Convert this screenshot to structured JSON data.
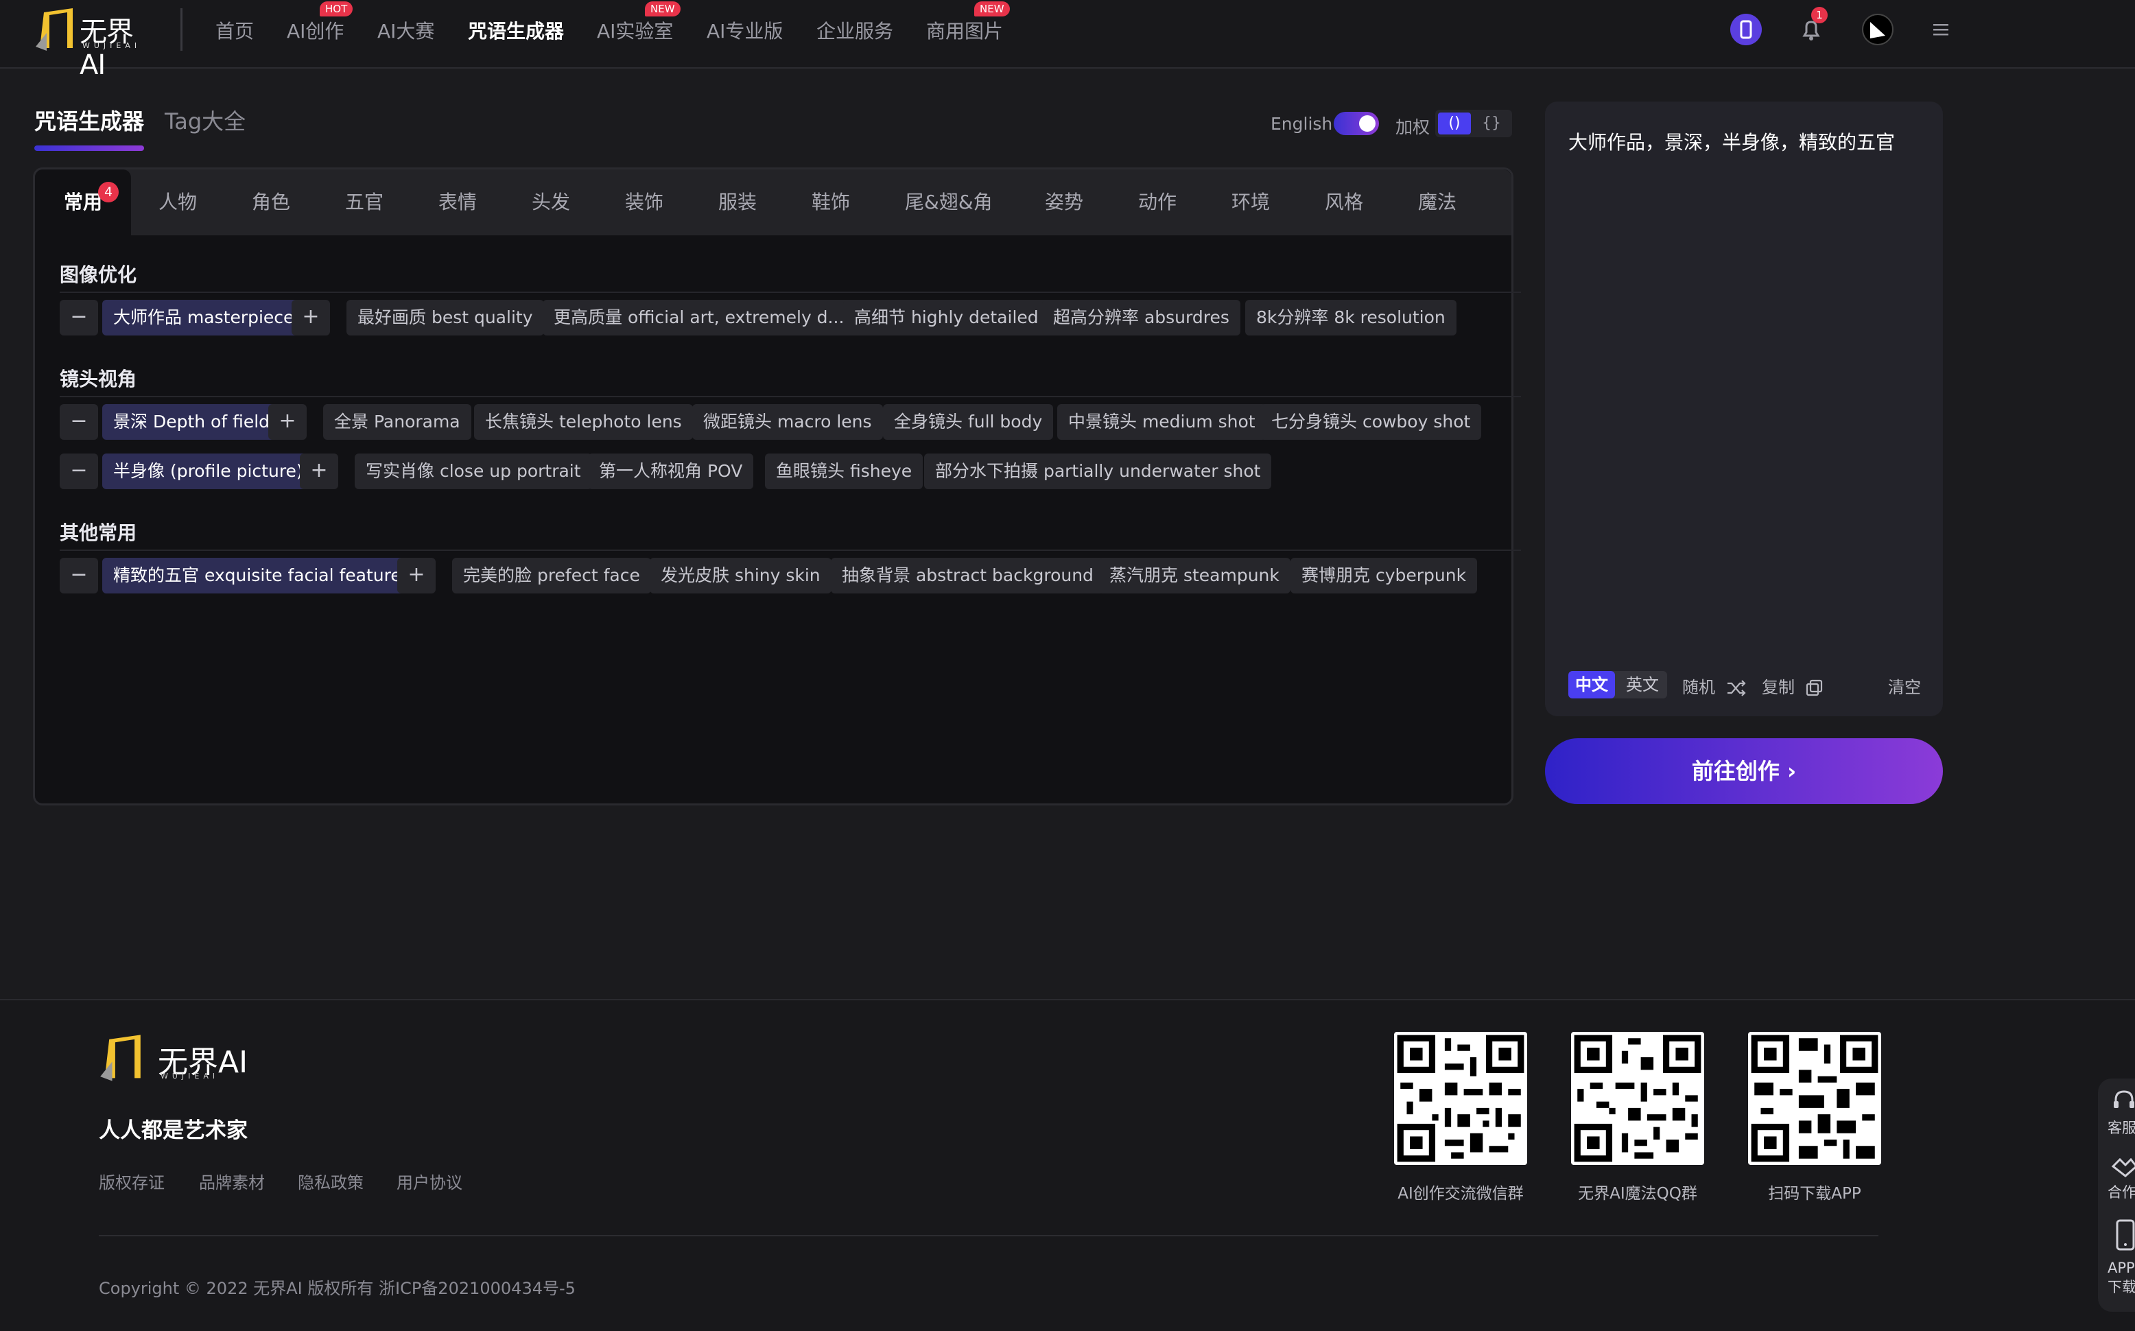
{
  "header": {
    "logo_text": "无界AI",
    "logo_sub": "WUJIEAI",
    "nav": [
      {
        "label": "首页"
      },
      {
        "label": "AI创作",
        "badge": "HOT"
      },
      {
        "label": "AI大赛"
      },
      {
        "label": "咒语生成器",
        "active": true
      },
      {
        "label": "AI实验室",
        "badge": "NEW"
      },
      {
        "label": "AI专业版"
      },
      {
        "label": "企业服务"
      },
      {
        "label": "商用图片",
        "badge": "NEW"
      }
    ],
    "notification_count": "1"
  },
  "main_tabs": [
    {
      "label": "咒语生成器",
      "active": true
    },
    {
      "label": "Tag大全"
    }
  ],
  "controls": {
    "english_label": "English",
    "english_on": true,
    "weight_label": "加权",
    "weight_options": [
      "()",
      "{}"
    ],
    "weight_selected": "()"
  },
  "categories": {
    "items": [
      "常用",
      "人物",
      "角色",
      "五官",
      "表情",
      "头发",
      "装饰",
      "服装",
      "鞋饰",
      "尾&翅&角",
      "姿势",
      "动作",
      "环境",
      "风格",
      "魔法"
    ],
    "active": "常用",
    "active_count": "4"
  },
  "sections": [
    {
      "title": "图像优化",
      "rows": [
        [
          {
            "label": "大师作品 masterpiece",
            "selected": true
          },
          {
            "label": "最好画质 best quality"
          },
          {
            "label": "更高质量 official art, extremely d..."
          },
          {
            "label": "高细节 highly detailed"
          },
          {
            "label": "超高分辨率 absurdres"
          },
          {
            "label": "8k分辨率 8k resolution"
          }
        ]
      ]
    },
    {
      "title": "镜头视角",
      "rows": [
        [
          {
            "label": "景深 Depth of field",
            "selected": true
          },
          {
            "label": "全景 Panorama"
          },
          {
            "label": "长焦镜头 telephoto lens"
          },
          {
            "label": "微距镜头 macro lens"
          },
          {
            "label": "全身镜头 full body"
          },
          {
            "label": "中景镜头 medium shot"
          },
          {
            "label": "七分身镜头 cowboy shot"
          }
        ],
        [
          {
            "label": "半身像 (profile picture)",
            "selected": true
          },
          {
            "label": "写实肖像 close up portrait"
          },
          {
            "label": "第一人称视角 POV"
          },
          {
            "label": "鱼眼镜头 fisheye"
          },
          {
            "label": "部分水下拍摄 partially underwater shot"
          }
        ]
      ]
    },
    {
      "title": "其他常用",
      "rows": [
        [
          {
            "label": "精致的五官 exquisite facial features",
            "selected": true
          },
          {
            "label": "完美的脸 prefect face"
          },
          {
            "label": "发光皮肤 shiny skin"
          },
          {
            "label": "抽象背景 abstract background"
          },
          {
            "label": "蒸汽朋克 steampunk"
          },
          {
            "label": "赛博朋克 cyberpunk"
          }
        ]
      ]
    }
  ],
  "prompt_panel": {
    "text": "大师作品，景深，半身像，精致的五官",
    "lang_options": [
      "中文",
      "英文"
    ],
    "lang_selected": "中文",
    "random_label": "随机",
    "copy_label": "复制",
    "clear_label": "清空",
    "cta_label": "前往创作 ›"
  },
  "footer": {
    "slogan": "人人都是艺术家",
    "links": [
      "版权存证",
      "品牌素材",
      "隐私政策",
      "用户协议"
    ],
    "qr_codes": [
      {
        "caption": "AI创作交流微信群"
      },
      {
        "caption": "无界AI魔法QQ群"
      },
      {
        "caption": "扫码下载APP"
      }
    ],
    "copyright": "Copyright © 2022 无界AI 版权所有 浙ICP备2021000434号-5",
    "float_items": [
      "客服",
      "合作",
      "APP下载"
    ]
  },
  "colors": {
    "accent_start": "#3b32d4",
    "accent_end": "#8e3bd6",
    "badge_red": "#e8334a",
    "selected_chip": "#2d2d55",
    "bg": "#1b1b1e"
  },
  "icons": {
    "header_right": [
      "phone-icon",
      "bell-icon",
      "avatar",
      "menu-icon"
    ],
    "prompt_actions": [
      "shuffle-icon",
      "copy-icon"
    ]
  }
}
